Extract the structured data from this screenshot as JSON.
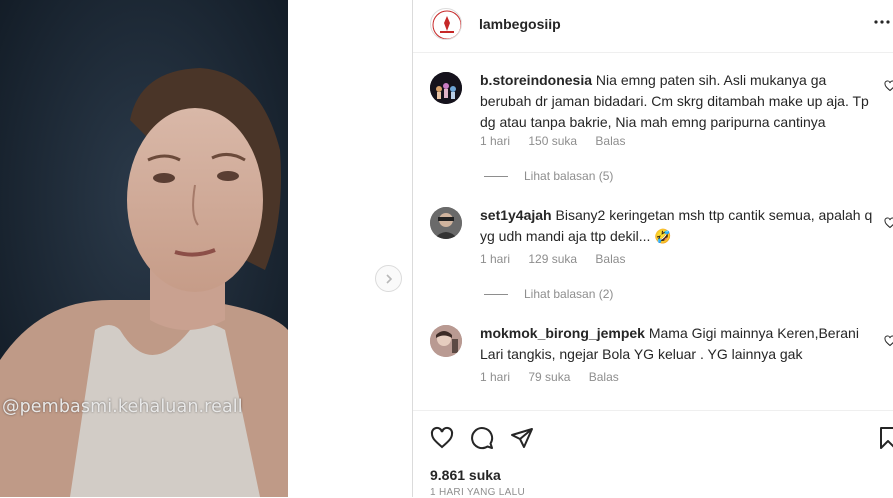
{
  "post": {
    "watermark": "@pembasmi.kehaluan.reall"
  },
  "header": {
    "username": "lambegosiip",
    "more_icon": "more-horizontal-icon"
  },
  "comments": [
    {
      "username": "b.storeindonesia",
      "text": "Nia emng paten sih. Asli mukanya ga berubah dr jaman bidadari. Cm skrg ditambah make up aja. Tp dg atau tanpa bakrie, Nia mah emng paripurna cantinya",
      "time": "1 hari",
      "likes": "150 suka",
      "reply": "Balas",
      "view_replies": "Lihat balasan (5)"
    },
    {
      "username": "set1y4ajah",
      "text": "Bisany2 keringetan msh ttp cantik semua, apalah q yg udh mandi aja ttp dekil...",
      "emoji": "🤣",
      "time": "1 hari",
      "likes": "129 suka",
      "reply": "Balas",
      "view_replies": "Lihat balasan (2)"
    },
    {
      "username": "mokmok_birong_jempek",
      "text": "Mama Gigi mainnya Keren,Berani Lari tangkis, ngejar Bola YG keluar . YG lainnya gak",
      "time": "1 hari",
      "likes": "79 suka",
      "reply": "Balas"
    }
  ],
  "footer": {
    "likes": "9.861 suka",
    "time_ago": "1 HARI YANG LALU"
  },
  "icons": [
    "heart-icon",
    "comment-icon",
    "share-icon",
    "bookmark-icon",
    "chevron-right-icon"
  ],
  "colors": {
    "text": "#262626",
    "secondary": "#8e8e8e",
    "border": "#dbdbdb"
  }
}
